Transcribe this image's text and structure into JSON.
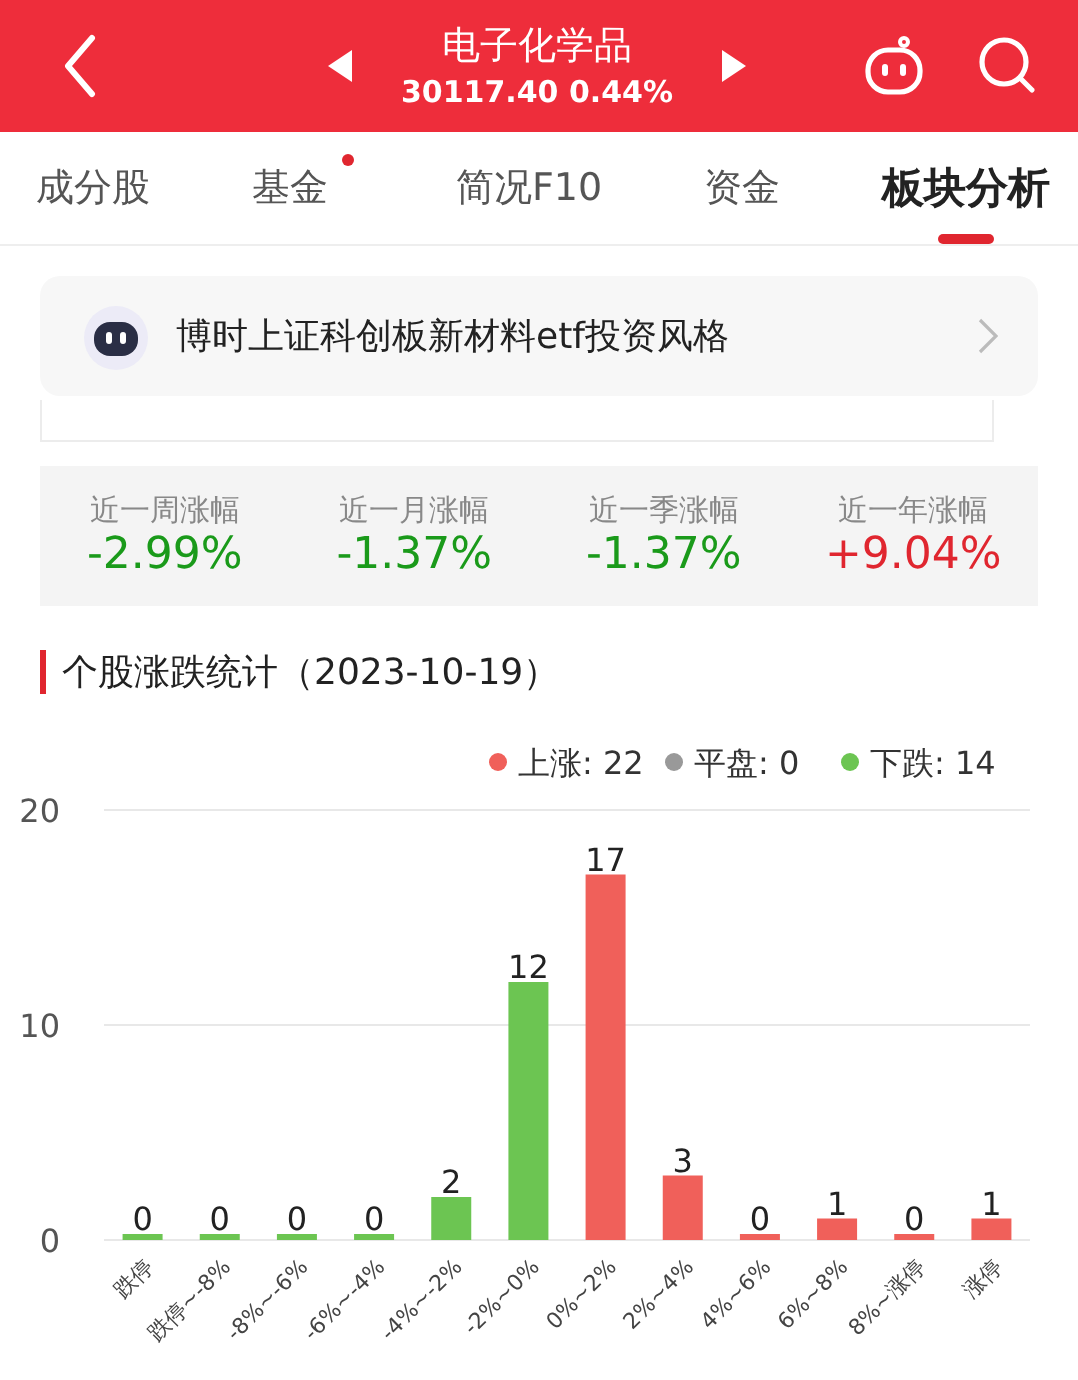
{
  "header": {
    "title": "电子化学品",
    "quote": "30117.40 0.44%"
  },
  "tabs": [
    {
      "label": "成分股",
      "selected": false,
      "dot": false
    },
    {
      "label": "基金",
      "selected": false,
      "dot": true
    },
    {
      "label": "简况F10",
      "selected": false,
      "dot": false
    },
    {
      "label": "资金",
      "selected": false,
      "dot": false
    },
    {
      "label": "板块分析",
      "selected": true,
      "dot": false
    }
  ],
  "banner": {
    "text": "博时上证科创板新材料etf投资风格"
  },
  "stats": [
    {
      "label": "近一周涨幅",
      "value": "-2.99%",
      "color": "#1a9a1a"
    },
    {
      "label": "近一月涨幅",
      "value": "-1.37%",
      "color": "#1a9a1a"
    },
    {
      "label": "近一季涨幅",
      "value": "-1.37%",
      "color": "#1a9a1a"
    },
    {
      "label": "近一年涨幅",
      "value": "+9.04%",
      "color": "#e0262f"
    }
  ],
  "section_title": "个股涨跌统计（2023-10-19）",
  "legend": [
    {
      "label": "上涨: 22",
      "color": "#f0605a"
    },
    {
      "label": "平盘: 0",
      "color": "#999999"
    },
    {
      "label": "下跌: 14",
      "color": "#6cc552"
    }
  ],
  "chart_data": {
    "type": "bar",
    "categories": [
      "跌停",
      "跌停~-8%",
      "-8%~-6%",
      "-6%~-4%",
      "-4%~-2%",
      "-2%~0%",
      "0%~2%",
      "2%~4%",
      "4%~6%",
      "6%~8%",
      "8%~涨停",
      "涨停"
    ],
    "series": [
      {
        "color": "#6cc552",
        "values": [
          0,
          0,
          0,
          0,
          2,
          12,
          null,
          null,
          null,
          null,
          null,
          null
        ]
      },
      {
        "color": "#f0605a",
        "values": [
          null,
          null,
          null,
          null,
          null,
          null,
          17,
          3,
          0,
          1,
          0,
          1
        ]
      }
    ],
    "ylim": [
      0,
      20
    ],
    "yticks": [
      0,
      10,
      20
    ],
    "data_labels": true
  }
}
